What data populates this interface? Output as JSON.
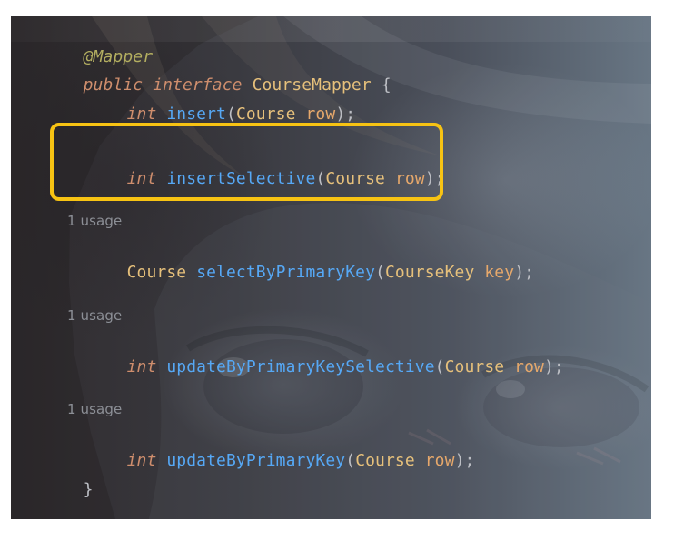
{
  "editor": {
    "background_icon": "anime-face-background",
    "lines": {
      "annotation": "@Mapper",
      "interface_public": "public",
      "interface_word": "interface",
      "interface_name": "CourseMapper",
      "interface_brace": "{",
      "insert_type": "int",
      "insert_method": "insert",
      "insert_open": "(",
      "insert_param_type": "Course",
      "insert_param_name": "row",
      "insert_close": ");",
      "insert_selective_type": "int",
      "insert_selective_method": "insertSelective",
      "insert_selective_open": "(",
      "insert_selective_param_type": "Course",
      "insert_selective_param_name": "row",
      "insert_selective_close": ");",
      "usage_1": "1 usage",
      "select_return_type": "Course",
      "select_method": "selectByPrimaryKey",
      "select_open": "(",
      "select_param_type": "CourseKey",
      "select_param_name": "key",
      "select_close": ");",
      "usage_2": "1 usage",
      "update_selective_type": "int",
      "update_selective_method": "updateByPrimaryKeySelective",
      "update_selective_open": "(",
      "update_selective_param_type": "Course",
      "update_selective_param_name": "row",
      "update_selective_close": ");",
      "usage_3": "1 usage",
      "update_type": "int",
      "update_method": "updateByPrimaryKey",
      "update_open": "(",
      "update_param_type": "Course",
      "update_param_name": "row",
      "update_close": ");",
      "closing_brace": "}"
    },
    "colors": {
      "highlight_box": "#f7c313",
      "keyword": "#cf8e6d",
      "method": "#56a8f5",
      "class_name": "#e6c07b",
      "parameter": "#e6a86b",
      "usage_hint": "#8c8f96"
    }
  }
}
